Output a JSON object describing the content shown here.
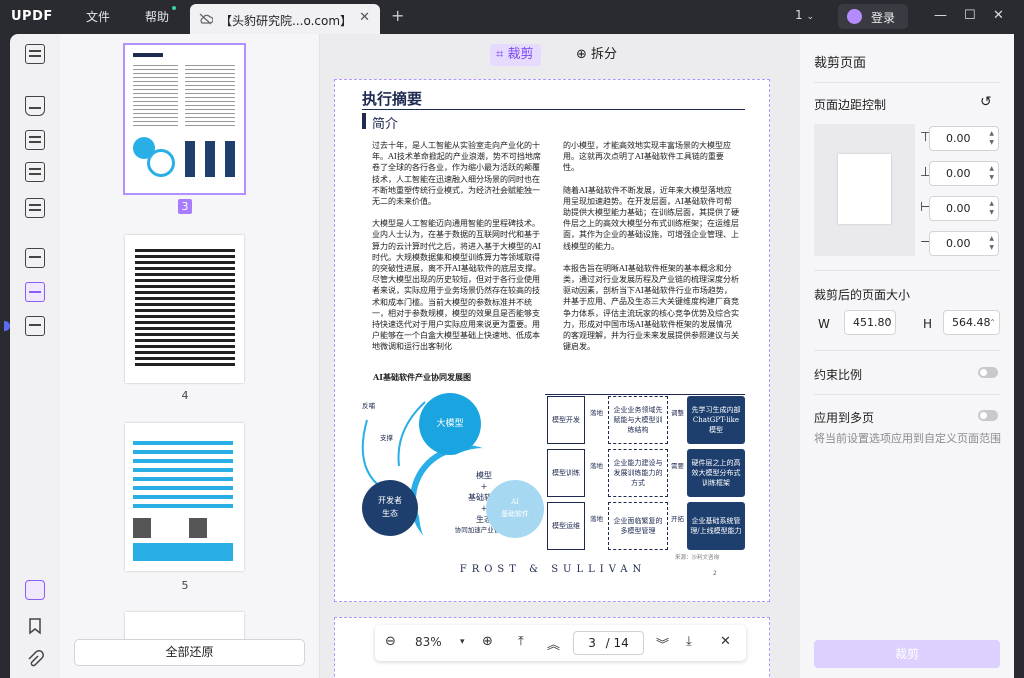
{
  "app": {
    "logo": "UPDF",
    "menu_file": "文件",
    "menu_help": "帮助",
    "tab_title": "【头豹研究院...o.com】",
    "page_selector": "1",
    "login": "登录"
  },
  "toolbar": {
    "crop": "裁剪",
    "split": "拆分"
  },
  "thumbs": {
    "labels": [
      "3",
      "4",
      "5"
    ],
    "restore": "全部还原"
  },
  "document": {
    "heading": "执行摘要",
    "subheading": "简介",
    "col1": [
      "过去十年，是人工智能从实验室走向产业化的十年。AI技术革命掀起的产业浪潮，势不可挡地席卷了全球的各行各业，作为缩小最为活跃的颠覆技术，人工智能在迅速融入细分场景的同时也在不断地重塑传统行业模式，为经济社会赋能独一无二的未来价值。",
      "大模型是人工智能迈向通用智能的里程碑技术。业内人士认为，在基于数据的互联网时代和基于算力的云计算时代之后，将进入基于大模型的AI时代。大规模数据集和模型训练算力等领域取得的突破性进展，离不开AI基础软件的底层支撑。尽管大模型出现的历史较短，但对于各行业使用者来说，实际应用于业务场景仍然存在较高的技术和成本门槛。当前大模型的参数标准并不统一，相对于参数规模，模型的效果且是否能够支持快速迭代对于用户实际应用来说更为重要。用户能够在一个白盒大模型基础上快速地、低成本地微调和运行出客制化"
    ],
    "caption": "AI基础软件产业协同发展图",
    "col2": [
      "的小模型，才能高效地实现丰富场景的大模型应用。这就再次点明了AI基础软件工具链的重要性。",
      "随着AI基础软件不断发展，近年来大模型落地应用呈现加速趋势。在开发层面，AI基础软件可帮助提供大模型能力基础；在训练层面，其提供了硬件层之上的高效大模型分布式训练框架；在运维层面，其作为企业的基础设施，可增强企业管理、上线模型的能力。",
      "本报告旨在明晰AI基础软件框架的基本概念和分类，通过对行业发展历程及产业链的梳理深度分析驱动因素，剖析当下AI基础软件行业市场趋势，并基于应用、产品及生态三大关键维度构建厂商竞争力体系，评估主流玩家的核心竞争优势及综合实力，形成对中国市场AI基础软件框架的发展情况的客观理解，并为行业未来发展提供参照建议与关键启发。"
    ],
    "diagram": {
      "c_big": "大模型",
      "c_center": [
        "模型",
        "+",
        "基础软件",
        "+",
        "生态",
        "协同加速产业智能化"
      ],
      "c_dev": [
        "开发者",
        "生态"
      ],
      "c_ai": [
        "AI",
        "基础软件"
      ],
      "fb": "反哺",
      "sup": "支撑",
      "left": [
        "模型开发",
        "模型训练",
        "模型运维"
      ],
      "mid": [
        "企业业务领域先赋能与大模型训练结构",
        "企业能力建设与发展训练能力的方式",
        "企业面临繁复的多模型管理"
      ],
      "ops": [
        "落地",
        "落地",
        "落地"
      ],
      "ops2": [
        "调整",
        "需要",
        "开拓"
      ],
      "right": [
        "先学习生成内部ChatGPT-like模型",
        "硬件层之上的高效大模型分布式训练框架",
        "企业基础系统管理/上线模型能力"
      ],
      "source": "来源：沙利文咨询"
    },
    "footer": "FROST & SULLIVAN",
    "pageno": "2"
  },
  "zoom": {
    "percent": "83%",
    "current": "3",
    "total": "/ 14"
  },
  "crop": {
    "title": "裁剪页面",
    "margin_title": "页面边距控制",
    "margins": [
      "0.00",
      "0.00",
      "0.00",
      "0.00"
    ],
    "size_title": "裁剪后的页面大小",
    "w_label": "W",
    "w": "451.80",
    "h_label": "H",
    "h": "564.48",
    "ratio": "约束比例",
    "multi": "应用到多页",
    "multi_desc": "将当前设置选项应用到自定义页面范围",
    "btn": "裁剪"
  }
}
